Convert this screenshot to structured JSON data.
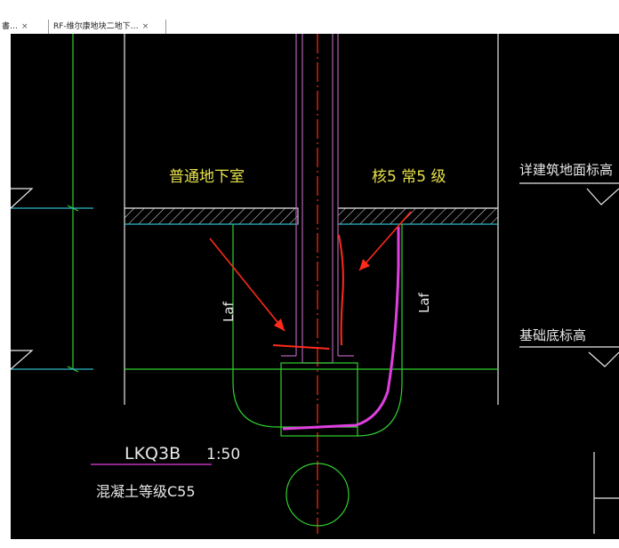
{
  "tabs": [
    {
      "label": "書…",
      "close": "×"
    },
    {
      "label": "RF-维尔康地块二地下…",
      "close": "×"
    }
  ],
  "drawing": {
    "label_basement": "普通地下室",
    "label_grade": "核5 常5 级",
    "label_floor_elev": "详建筑地面标高",
    "label_base_elev": "基础底标高",
    "label_laf_left": "Laf",
    "label_laf_right": "Laf",
    "title_code": "LKQ3B",
    "title_scale": "1:50",
    "concrete_grade": "混凝土等级C55"
  },
  "colors": {
    "background": "#000000",
    "green": "#2fd32f",
    "cyan": "#2fb8c8",
    "yellow": "#e8e24a",
    "magenta": "#e040e0",
    "red": "#ff2a1a",
    "white": "#e8e8e8",
    "purple": "#b060b0"
  }
}
